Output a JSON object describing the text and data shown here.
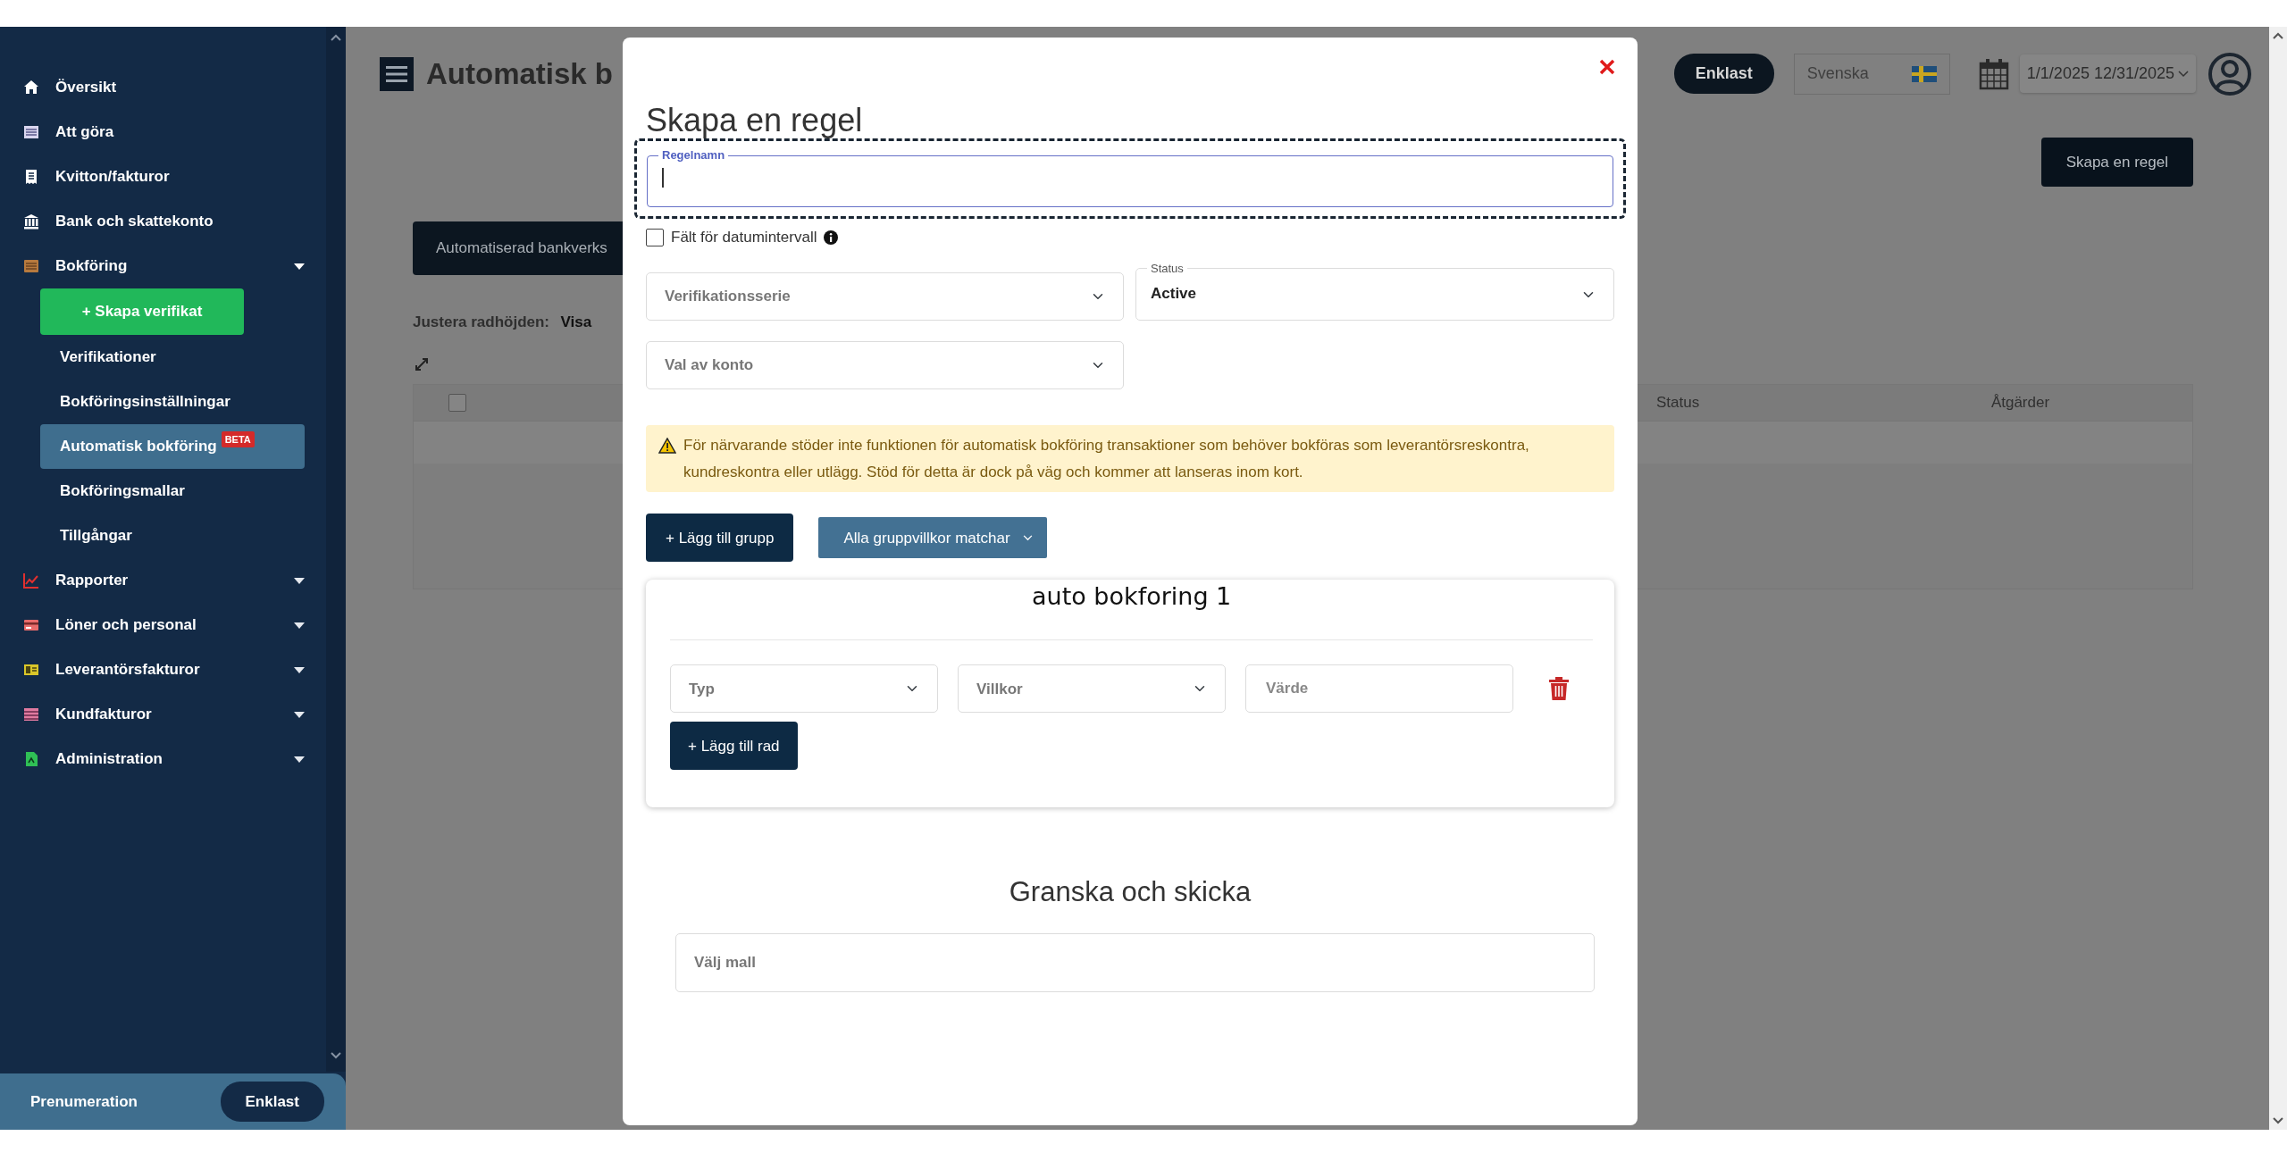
{
  "sidebar": {
    "items": [
      {
        "label": "Översikt",
        "kind": "link"
      },
      {
        "label": "Att göra",
        "kind": "link"
      },
      {
        "label": "Kvitton/fakturor",
        "kind": "link"
      },
      {
        "label": "Bank och skattekonto",
        "kind": "link"
      },
      {
        "label": "Bokföring",
        "kind": "group",
        "expanded": true,
        "children": [
          {
            "label": "+ Skapa verifikat",
            "kind": "button",
            "selected": false
          },
          {
            "label": "Verifikationer",
            "kind": "link",
            "selected": false
          },
          {
            "label": "Bokföringsinställningar",
            "kind": "link",
            "selected": false
          },
          {
            "label": "Automatisk bokföring",
            "kind": "link",
            "selected": true,
            "badge": "BETA"
          },
          {
            "label": "Bokföringsmallar",
            "kind": "link",
            "selected": false
          },
          {
            "label": "Tillgångar",
            "kind": "link",
            "selected": false
          }
        ]
      },
      {
        "label": "Rapporter",
        "kind": "group",
        "expanded": false
      },
      {
        "label": "Löner och personal",
        "kind": "group",
        "expanded": false
      },
      {
        "label": "Leverantörsfakturor",
        "kind": "group",
        "expanded": false
      },
      {
        "label": "Kundfakturor",
        "kind": "group",
        "expanded": false
      },
      {
        "label": "Administration",
        "kind": "group",
        "expanded": false
      }
    ],
    "footer": {
      "label": "Prenumeration",
      "plan": "Enklast"
    }
  },
  "page": {
    "title": "Automatisk b",
    "plan": "Enklast",
    "language": "Svenska",
    "date_range": "1/1/2025 12/31/2025",
    "create_button": "Skapa en regel",
    "tab": "Automatiserad bankverks",
    "row_height_label": "Justera radhöjden:",
    "row_height_value": "Visa",
    "table": {
      "select_all_checked": false,
      "columns": [
        "Status",
        "Åtgärder"
      ]
    }
  },
  "modal": {
    "title": "Skapa en regel",
    "name_field": {
      "label": "Regelnamn",
      "focused": true
    },
    "date_checkbox": {
      "label": "Fält för datumintervall",
      "checked": false
    },
    "series_select": {
      "placeholder": "Verifikationsserie"
    },
    "status_select": {
      "label": "Status",
      "value": "Active"
    },
    "account_select": {
      "placeholder": "Val av konto"
    },
    "alert": "För närvarande stöder inte funktionen för automatisk bokföring transaktioner som behöver bokföras som leverantörsreskontra, kundreskontra eller utlägg. Stöd för detta är dock på väg och kommer att lanseras inom kort.",
    "add_group_button": "+ Lägg till grupp",
    "match_select": "Alla gruppvillkor matchar",
    "annotation": "auto bokforing 1",
    "group": {
      "conditions": [
        {
          "type_placeholder": "Typ",
          "condition_placeholder": "Villkor",
          "value_placeholder": "Värde"
        }
      ],
      "add_row_button": "+ Lägg till rad"
    },
    "review": {
      "title": "Granska och skicka",
      "template_placeholder": "Välj mall"
    }
  }
}
